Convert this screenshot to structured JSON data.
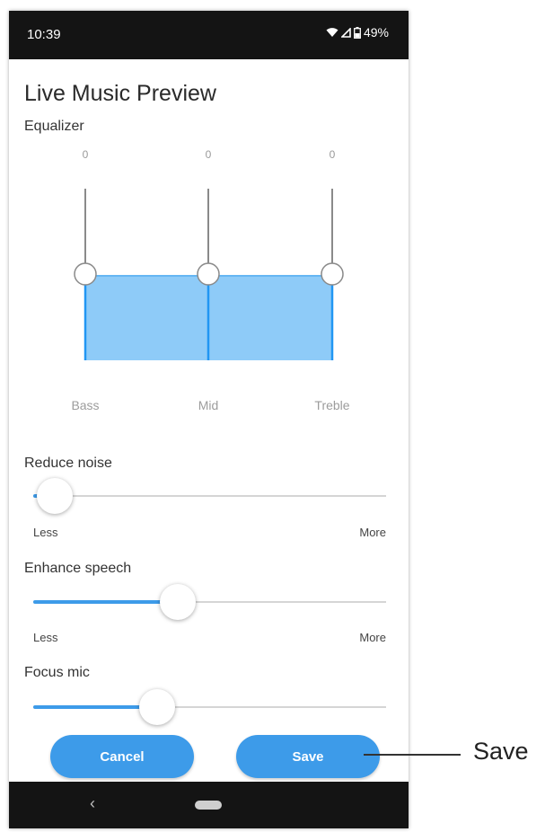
{
  "status_bar": {
    "time": "10:39",
    "battery": "49%"
  },
  "screen": {
    "title": "Live Music Preview"
  },
  "equalizer": {
    "label": "Equalizer",
    "bands": [
      {
        "name": "Bass",
        "value": "0"
      },
      {
        "name": "Mid",
        "value": "0"
      },
      {
        "name": "Treble",
        "value": "0"
      }
    ]
  },
  "settings": {
    "reduce_noise": {
      "label": "Reduce noise",
      "min_label": "Less",
      "max_label": "More",
      "level": 0.06
    },
    "enhance_speech": {
      "label": "Enhance speech",
      "min_label": "Less",
      "max_label": "More",
      "level": 0.41
    },
    "focus_mic": {
      "label": "Focus mic",
      "level": 0.35
    }
  },
  "buttons": {
    "cancel": "Cancel",
    "save": "Save"
  },
  "callout": {
    "label": "Save"
  },
  "colors": {
    "accent": "#3d9be9",
    "eq_fill": "#8ecbf8",
    "bars": "#141414"
  },
  "icons": [
    "wifi-icon",
    "signal-icon",
    "battery-icon",
    "nav-back-icon",
    "nav-home-pill"
  ]
}
